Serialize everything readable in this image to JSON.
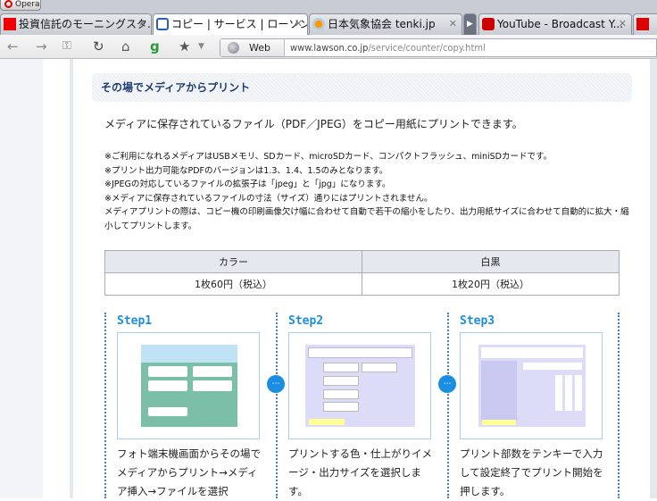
{
  "browser": {
    "menu_label": "Opera",
    "tabs": [
      {
        "title": "投資信託のモーニングスタ...",
        "icon": "morningstar-icon",
        "active": false
      },
      {
        "title": "コピー | サービス | ローソン",
        "icon": "lawson-icon",
        "active": true
      },
      {
        "title": "日本気象協会 tenki.jp",
        "icon": "weather-icon",
        "active": false
      },
      {
        "title": "YouTube - Broadcast Y...",
        "icon": "youtube-icon",
        "active": false
      }
    ],
    "address": {
      "search_engine": "Web",
      "url_domain": "www.lawson.co.jp",
      "url_path": "/service/counter/copy.html"
    }
  },
  "page": {
    "section_title": "その場でメディアからプリント",
    "intro": "メディアに保存されているファイル（PDF／JPEG）をコピー用紙にプリントできます。",
    "notes": [
      "※ご利用になれるメディアはUSBメモリ、SDカード、microSDカード、コンパクトフラッシュ、miniSDカードです。",
      "※プリント出力可能なPDFのバージョンは1.3、1.4、1.5のみとなります。",
      "※JPEGの対応しているファイルの拡張子は「jpeg」と「jpg」になります。",
      "※メディアに保存されているファイルの寸法（サイズ）通りにはプリントされません。",
      "メディアプリントの際は、コピー機の印刷画像欠け幅に合わせて自動で若干の縮小をしたり、出力用紙サイズに合わせて自動的に拡大・縮小してプリントします。"
    ],
    "price_table": {
      "headers": [
        "カラー",
        "白黒"
      ],
      "values": [
        "1枚60円（税込）",
        "1枚20円（税込）"
      ]
    },
    "steps": [
      {
        "label": "Step1",
        "description": "フォト端末機画面からその場でメディアからプリント→メディア挿入→ファイルを選択"
      },
      {
        "label": "Step2",
        "description": "プリントする色・仕上がりイメージ・出力サイズを選択します。"
      },
      {
        "label": "Step3",
        "description": "プリント部数をテンキーで入力して設定終了でプリント開始を押します。"
      }
    ]
  }
}
